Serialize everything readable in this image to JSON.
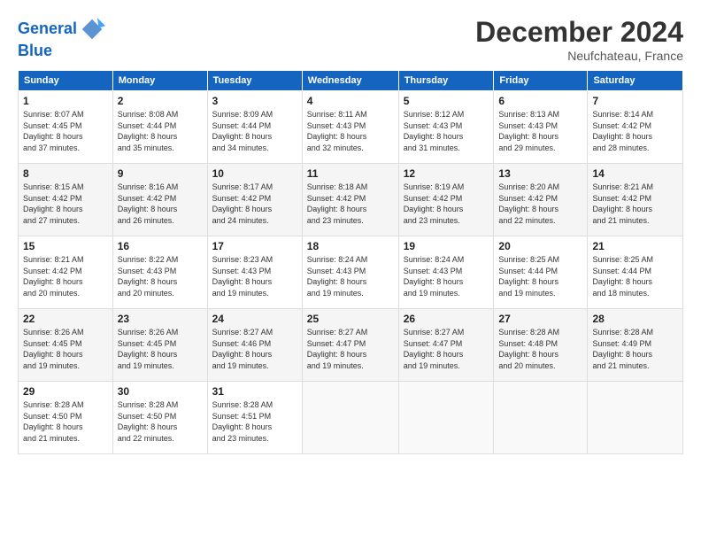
{
  "header": {
    "logo_line1": "General",
    "logo_line2": "Blue",
    "month": "December 2024",
    "location": "Neufchateau, France"
  },
  "days_of_week": [
    "Sunday",
    "Monday",
    "Tuesday",
    "Wednesday",
    "Thursday",
    "Friday",
    "Saturday"
  ],
  "weeks": [
    [
      {
        "day": "1",
        "sunrise": "8:07 AM",
        "sunset": "4:45 PM",
        "daylight": "8 hours and 37 minutes."
      },
      {
        "day": "2",
        "sunrise": "8:08 AM",
        "sunset": "4:44 PM",
        "daylight": "8 hours and 35 minutes."
      },
      {
        "day": "3",
        "sunrise": "8:09 AM",
        "sunset": "4:44 PM",
        "daylight": "8 hours and 34 minutes."
      },
      {
        "day": "4",
        "sunrise": "8:11 AM",
        "sunset": "4:43 PM",
        "daylight": "8 hours and 32 minutes."
      },
      {
        "day": "5",
        "sunrise": "8:12 AM",
        "sunset": "4:43 PM",
        "daylight": "8 hours and 31 minutes."
      },
      {
        "day": "6",
        "sunrise": "8:13 AM",
        "sunset": "4:43 PM",
        "daylight": "8 hours and 29 minutes."
      },
      {
        "day": "7",
        "sunrise": "8:14 AM",
        "sunset": "4:42 PM",
        "daylight": "8 hours and 28 minutes."
      }
    ],
    [
      {
        "day": "8",
        "sunrise": "8:15 AM",
        "sunset": "4:42 PM",
        "daylight": "8 hours and 27 minutes."
      },
      {
        "day": "9",
        "sunrise": "8:16 AM",
        "sunset": "4:42 PM",
        "daylight": "8 hours and 26 minutes."
      },
      {
        "day": "10",
        "sunrise": "8:17 AM",
        "sunset": "4:42 PM",
        "daylight": "8 hours and 24 minutes."
      },
      {
        "day": "11",
        "sunrise": "8:18 AM",
        "sunset": "4:42 PM",
        "daylight": "8 hours and 23 minutes."
      },
      {
        "day": "12",
        "sunrise": "8:19 AM",
        "sunset": "4:42 PM",
        "daylight": "8 hours and 23 minutes."
      },
      {
        "day": "13",
        "sunrise": "8:20 AM",
        "sunset": "4:42 PM",
        "daylight": "8 hours and 22 minutes."
      },
      {
        "day": "14",
        "sunrise": "8:21 AM",
        "sunset": "4:42 PM",
        "daylight": "8 hours and 21 minutes."
      }
    ],
    [
      {
        "day": "15",
        "sunrise": "8:21 AM",
        "sunset": "4:42 PM",
        "daylight": "8 hours and 20 minutes."
      },
      {
        "day": "16",
        "sunrise": "8:22 AM",
        "sunset": "4:43 PM",
        "daylight": "8 hours and 20 minutes."
      },
      {
        "day": "17",
        "sunrise": "8:23 AM",
        "sunset": "4:43 PM",
        "daylight": "8 hours and 19 minutes."
      },
      {
        "day": "18",
        "sunrise": "8:24 AM",
        "sunset": "4:43 PM",
        "daylight": "8 hours and 19 minutes."
      },
      {
        "day": "19",
        "sunrise": "8:24 AM",
        "sunset": "4:43 PM",
        "daylight": "8 hours and 19 minutes."
      },
      {
        "day": "20",
        "sunrise": "8:25 AM",
        "sunset": "4:44 PM",
        "daylight": "8 hours and 19 minutes."
      },
      {
        "day": "21",
        "sunrise": "8:25 AM",
        "sunset": "4:44 PM",
        "daylight": "8 hours and 18 minutes."
      }
    ],
    [
      {
        "day": "22",
        "sunrise": "8:26 AM",
        "sunset": "4:45 PM",
        "daylight": "8 hours and 19 minutes."
      },
      {
        "day": "23",
        "sunrise": "8:26 AM",
        "sunset": "4:45 PM",
        "daylight": "8 hours and 19 minutes."
      },
      {
        "day": "24",
        "sunrise": "8:27 AM",
        "sunset": "4:46 PM",
        "daylight": "8 hours and 19 minutes."
      },
      {
        "day": "25",
        "sunrise": "8:27 AM",
        "sunset": "4:47 PM",
        "daylight": "8 hours and 19 minutes."
      },
      {
        "day": "26",
        "sunrise": "8:27 AM",
        "sunset": "4:47 PM",
        "daylight": "8 hours and 19 minutes."
      },
      {
        "day": "27",
        "sunrise": "8:28 AM",
        "sunset": "4:48 PM",
        "daylight": "8 hours and 20 minutes."
      },
      {
        "day": "28",
        "sunrise": "8:28 AM",
        "sunset": "4:49 PM",
        "daylight": "8 hours and 21 minutes."
      }
    ],
    [
      {
        "day": "29",
        "sunrise": "8:28 AM",
        "sunset": "4:50 PM",
        "daylight": "8 hours and 21 minutes."
      },
      {
        "day": "30",
        "sunrise": "8:28 AM",
        "sunset": "4:50 PM",
        "daylight": "8 hours and 22 minutes."
      },
      {
        "day": "31",
        "sunrise": "8:28 AM",
        "sunset": "4:51 PM",
        "daylight": "8 hours and 23 minutes."
      },
      null,
      null,
      null,
      null
    ]
  ]
}
